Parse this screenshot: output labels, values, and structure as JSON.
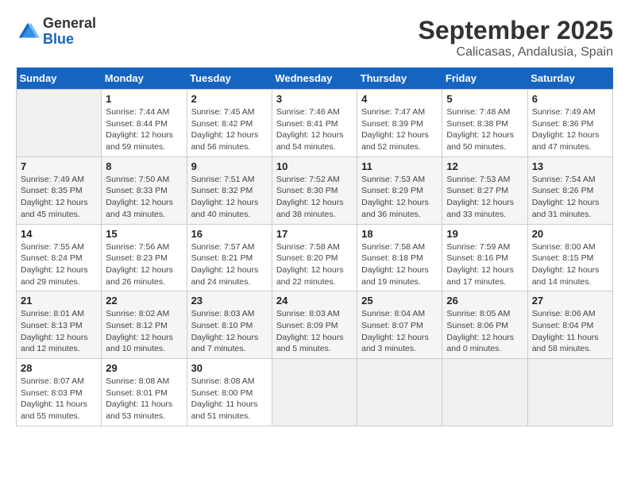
{
  "logo": {
    "general": "General",
    "blue": "Blue"
  },
  "title": "September 2025",
  "subtitle": "Calicasas, Andalusia, Spain",
  "days_of_week": [
    "Sunday",
    "Monday",
    "Tuesday",
    "Wednesday",
    "Thursday",
    "Friday",
    "Saturday"
  ],
  "weeks": [
    [
      {
        "day": "",
        "info": ""
      },
      {
        "day": "1",
        "info": "Sunrise: 7:44 AM\nSunset: 8:44 PM\nDaylight: 12 hours\nand 59 minutes."
      },
      {
        "day": "2",
        "info": "Sunrise: 7:45 AM\nSunset: 8:42 PM\nDaylight: 12 hours\nand 56 minutes."
      },
      {
        "day": "3",
        "info": "Sunrise: 7:46 AM\nSunset: 8:41 PM\nDaylight: 12 hours\nand 54 minutes."
      },
      {
        "day": "4",
        "info": "Sunrise: 7:47 AM\nSunset: 8:39 PM\nDaylight: 12 hours\nand 52 minutes."
      },
      {
        "day": "5",
        "info": "Sunrise: 7:48 AM\nSunset: 8:38 PM\nDaylight: 12 hours\nand 50 minutes."
      },
      {
        "day": "6",
        "info": "Sunrise: 7:49 AM\nSunset: 8:36 PM\nDaylight: 12 hours\nand 47 minutes."
      }
    ],
    [
      {
        "day": "7",
        "info": "Sunrise: 7:49 AM\nSunset: 8:35 PM\nDaylight: 12 hours\nand 45 minutes."
      },
      {
        "day": "8",
        "info": "Sunrise: 7:50 AM\nSunset: 8:33 PM\nDaylight: 12 hours\nand 43 minutes."
      },
      {
        "day": "9",
        "info": "Sunrise: 7:51 AM\nSunset: 8:32 PM\nDaylight: 12 hours\nand 40 minutes."
      },
      {
        "day": "10",
        "info": "Sunrise: 7:52 AM\nSunset: 8:30 PM\nDaylight: 12 hours\nand 38 minutes."
      },
      {
        "day": "11",
        "info": "Sunrise: 7:53 AM\nSunset: 8:29 PM\nDaylight: 12 hours\nand 36 minutes."
      },
      {
        "day": "12",
        "info": "Sunrise: 7:53 AM\nSunset: 8:27 PM\nDaylight: 12 hours\nand 33 minutes."
      },
      {
        "day": "13",
        "info": "Sunrise: 7:54 AM\nSunset: 8:26 PM\nDaylight: 12 hours\nand 31 minutes."
      }
    ],
    [
      {
        "day": "14",
        "info": "Sunrise: 7:55 AM\nSunset: 8:24 PM\nDaylight: 12 hours\nand 29 minutes."
      },
      {
        "day": "15",
        "info": "Sunrise: 7:56 AM\nSunset: 8:23 PM\nDaylight: 12 hours\nand 26 minutes."
      },
      {
        "day": "16",
        "info": "Sunrise: 7:57 AM\nSunset: 8:21 PM\nDaylight: 12 hours\nand 24 minutes."
      },
      {
        "day": "17",
        "info": "Sunrise: 7:58 AM\nSunset: 8:20 PM\nDaylight: 12 hours\nand 22 minutes."
      },
      {
        "day": "18",
        "info": "Sunrise: 7:58 AM\nSunset: 8:18 PM\nDaylight: 12 hours\nand 19 minutes."
      },
      {
        "day": "19",
        "info": "Sunrise: 7:59 AM\nSunset: 8:16 PM\nDaylight: 12 hours\nand 17 minutes."
      },
      {
        "day": "20",
        "info": "Sunrise: 8:00 AM\nSunset: 8:15 PM\nDaylight: 12 hours\nand 14 minutes."
      }
    ],
    [
      {
        "day": "21",
        "info": "Sunrise: 8:01 AM\nSunset: 8:13 PM\nDaylight: 12 hours\nand 12 minutes."
      },
      {
        "day": "22",
        "info": "Sunrise: 8:02 AM\nSunset: 8:12 PM\nDaylight: 12 hours\nand 10 minutes."
      },
      {
        "day": "23",
        "info": "Sunrise: 8:03 AM\nSunset: 8:10 PM\nDaylight: 12 hours\nand 7 minutes."
      },
      {
        "day": "24",
        "info": "Sunrise: 8:03 AM\nSunset: 8:09 PM\nDaylight: 12 hours\nand 5 minutes."
      },
      {
        "day": "25",
        "info": "Sunrise: 8:04 AM\nSunset: 8:07 PM\nDaylight: 12 hours\nand 3 minutes."
      },
      {
        "day": "26",
        "info": "Sunrise: 8:05 AM\nSunset: 8:06 PM\nDaylight: 12 hours\nand 0 minutes."
      },
      {
        "day": "27",
        "info": "Sunrise: 8:06 AM\nSunset: 8:04 PM\nDaylight: 11 hours\nand 58 minutes."
      }
    ],
    [
      {
        "day": "28",
        "info": "Sunrise: 8:07 AM\nSunset: 8:03 PM\nDaylight: 11 hours\nand 55 minutes."
      },
      {
        "day": "29",
        "info": "Sunrise: 8:08 AM\nSunset: 8:01 PM\nDaylight: 11 hours\nand 53 minutes."
      },
      {
        "day": "30",
        "info": "Sunrise: 8:08 AM\nSunset: 8:00 PM\nDaylight: 11 hours\nand 51 minutes."
      },
      {
        "day": "",
        "info": ""
      },
      {
        "day": "",
        "info": ""
      },
      {
        "day": "",
        "info": ""
      },
      {
        "day": "",
        "info": ""
      }
    ]
  ]
}
